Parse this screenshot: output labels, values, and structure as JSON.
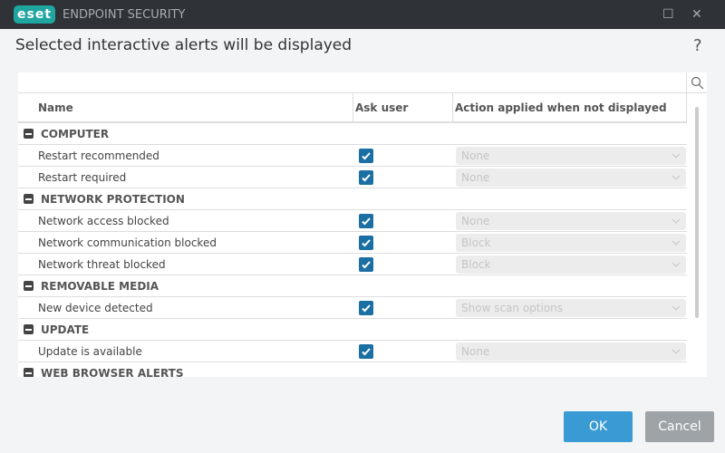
{
  "window": {
    "logo": "eset",
    "product": "ENDPOINT SECURITY"
  },
  "heading": "Selected interactive alerts will be displayed",
  "help": "?",
  "table": {
    "headers": [
      "Name",
      "Ask user",
      "Action applied when not displayed"
    ],
    "rows": [
      {
        "type": "group",
        "label": "COMPUTER"
      },
      {
        "type": "item",
        "label": "Restart recommended",
        "ask": true,
        "action": "None"
      },
      {
        "type": "item",
        "label": "Restart required",
        "ask": true,
        "action": "None"
      },
      {
        "type": "group",
        "label": "NETWORK PROTECTION"
      },
      {
        "type": "item",
        "label": "Network access blocked",
        "ask": true,
        "action": "None"
      },
      {
        "type": "item",
        "label": "Network communication blocked",
        "ask": true,
        "action": "Block"
      },
      {
        "type": "item",
        "label": "Network threat blocked",
        "ask": true,
        "action": "Block"
      },
      {
        "type": "group",
        "label": "REMOVABLE MEDIA"
      },
      {
        "type": "item",
        "label": "New device detected",
        "ask": true,
        "action": "Show scan options"
      },
      {
        "type": "group",
        "label": "UPDATE"
      },
      {
        "type": "item",
        "label": "Update is available",
        "ask": true,
        "action": "None"
      },
      {
        "type": "group",
        "label": "WEB BROWSER ALERTS"
      }
    ]
  },
  "buttons": {
    "ok": "OK",
    "cancel": "Cancel"
  }
}
